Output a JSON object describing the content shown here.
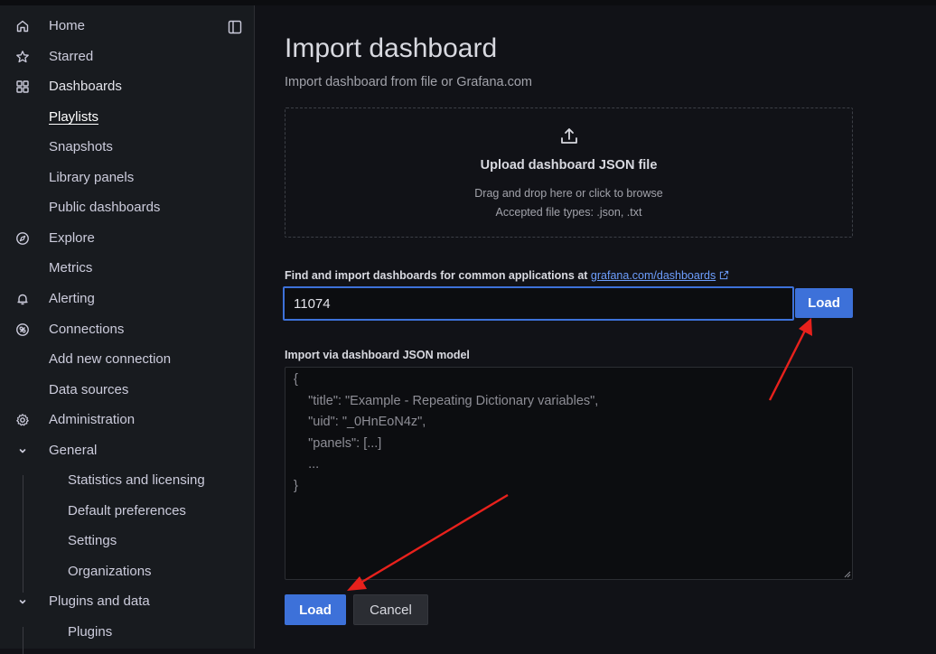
{
  "sidebar": {
    "items": [
      {
        "label": "Home",
        "icon": "home-icon"
      },
      {
        "label": "Starred",
        "icon": "star-icon"
      },
      {
        "label": "Dashboards",
        "icon": "apps-icon"
      },
      {
        "label": "Playlists"
      },
      {
        "label": "Snapshots"
      },
      {
        "label": "Library panels"
      },
      {
        "label": "Public dashboards"
      },
      {
        "label": "Explore",
        "icon": "compass-icon"
      },
      {
        "label": "Metrics"
      },
      {
        "label": "Alerting",
        "icon": "bell-icon"
      },
      {
        "label": "Connections",
        "icon": "connections-icon"
      },
      {
        "label": "Add new connection"
      },
      {
        "label": "Data sources"
      },
      {
        "label": "Administration",
        "icon": "cog-icon"
      },
      {
        "label": "General",
        "icon": "chevron-down-icon"
      },
      {
        "label": "Statistics and licensing"
      },
      {
        "label": "Default preferences"
      },
      {
        "label": "Settings"
      },
      {
        "label": "Organizations"
      },
      {
        "label": "Plugins and data",
        "icon": "chevron-down-icon"
      },
      {
        "label": "Plugins"
      }
    ],
    "active": "Playlists"
  },
  "main": {
    "title": "Import dashboard",
    "subtitle": "Import dashboard from file or Grafana.com",
    "upload": {
      "title": "Upload dashboard JSON file",
      "hint": "Drag and drop here or click to browse",
      "types": "Accepted file types: .json, .txt"
    },
    "find": {
      "label": "Find and import dashboards for common applications at ",
      "link": "grafana.com/dashboards",
      "value": "11074",
      "button": "Load"
    },
    "json": {
      "label": "Import via dashboard JSON model",
      "placeholder": "{\n    \"title\": \"Example - Repeating Dictionary variables\",\n    \"uid\": \"_0HnEoN4z\",\n    \"panels\": [...]\n    ...\n}"
    },
    "actions": {
      "load": "Load",
      "cancel": "Cancel"
    }
  },
  "colors": {
    "background": "#111217",
    "sidebar": "#181b1f",
    "primary": "#3d71d9",
    "annotation_arrow": "#e8211c"
  }
}
